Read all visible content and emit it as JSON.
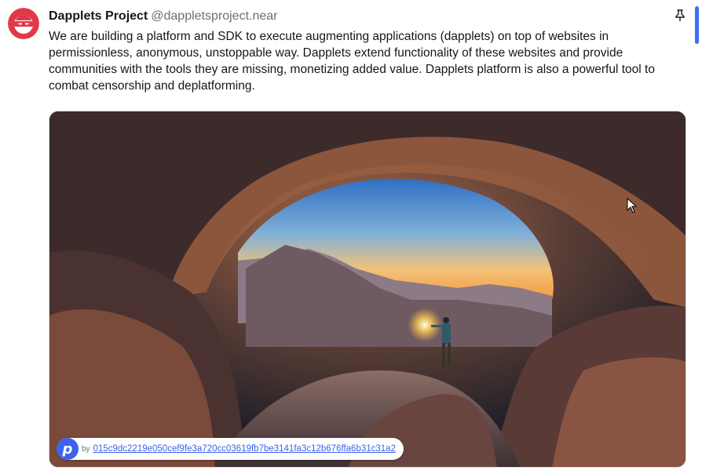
{
  "post": {
    "author_name": "Dapplets Project",
    "author_handle": "@dappletsproject.near",
    "text": "We are building a platform and SDK to execute augmenting applications (dapplets) on top of websites in permissionless, anonymous, unstoppable way. Dapplets extend functionality of these websites and provide communities with the tools they are missing, monetizing added value. Dapplets platform is also a powerful tool to combat censorship and deplatforming.",
    "pin_icon": "pin-icon",
    "avatar_icon": "ninja-mask-icon"
  },
  "media": {
    "image_icon": "rock-arch-landscape-photo"
  },
  "credit": {
    "logo_letter": "p",
    "by_label": "by",
    "hash": "015c9dc2219e050cef9fe3a720cc03619fb7be3141fa3c12b676ffa6b31c31a2"
  },
  "colors": {
    "accent": "#3b63f0",
    "avatar_red": "#e03a4a"
  }
}
